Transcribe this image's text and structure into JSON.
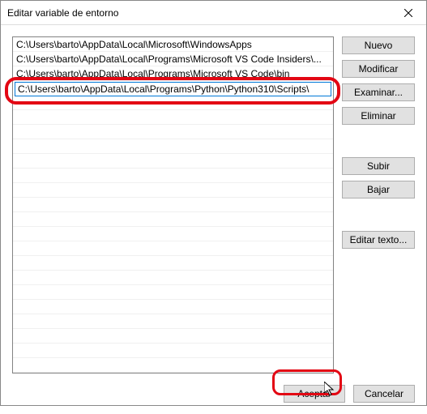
{
  "window": {
    "title": "Editar variable de entorno"
  },
  "list": {
    "items": [
      "C:\\Users\\barto\\AppData\\Local\\Microsoft\\WindowsApps",
      "C:\\Users\\barto\\AppData\\Local\\Programs\\Microsoft VS Code Insiders\\...",
      "C:\\Users\\barto\\AppData\\Local\\Programs\\Microsoft VS Code\\bin",
      "C:\\Users\\barto\\AppData\\Local\\Programs\\Python\\Python310\\Scripts\\"
    ],
    "editing_index": 3,
    "editing_value": "C:\\Users\\barto\\AppData\\Local\\Programs\\Python\\Python310\\Scripts\\"
  },
  "buttons": {
    "new": "Nuevo",
    "edit": "Modificar",
    "browse": "Examinar...",
    "delete": "Eliminar",
    "up": "Subir",
    "down": "Bajar",
    "edit_text": "Editar texto...",
    "ok": "Aceptar",
    "cancel": "Cancelar"
  }
}
